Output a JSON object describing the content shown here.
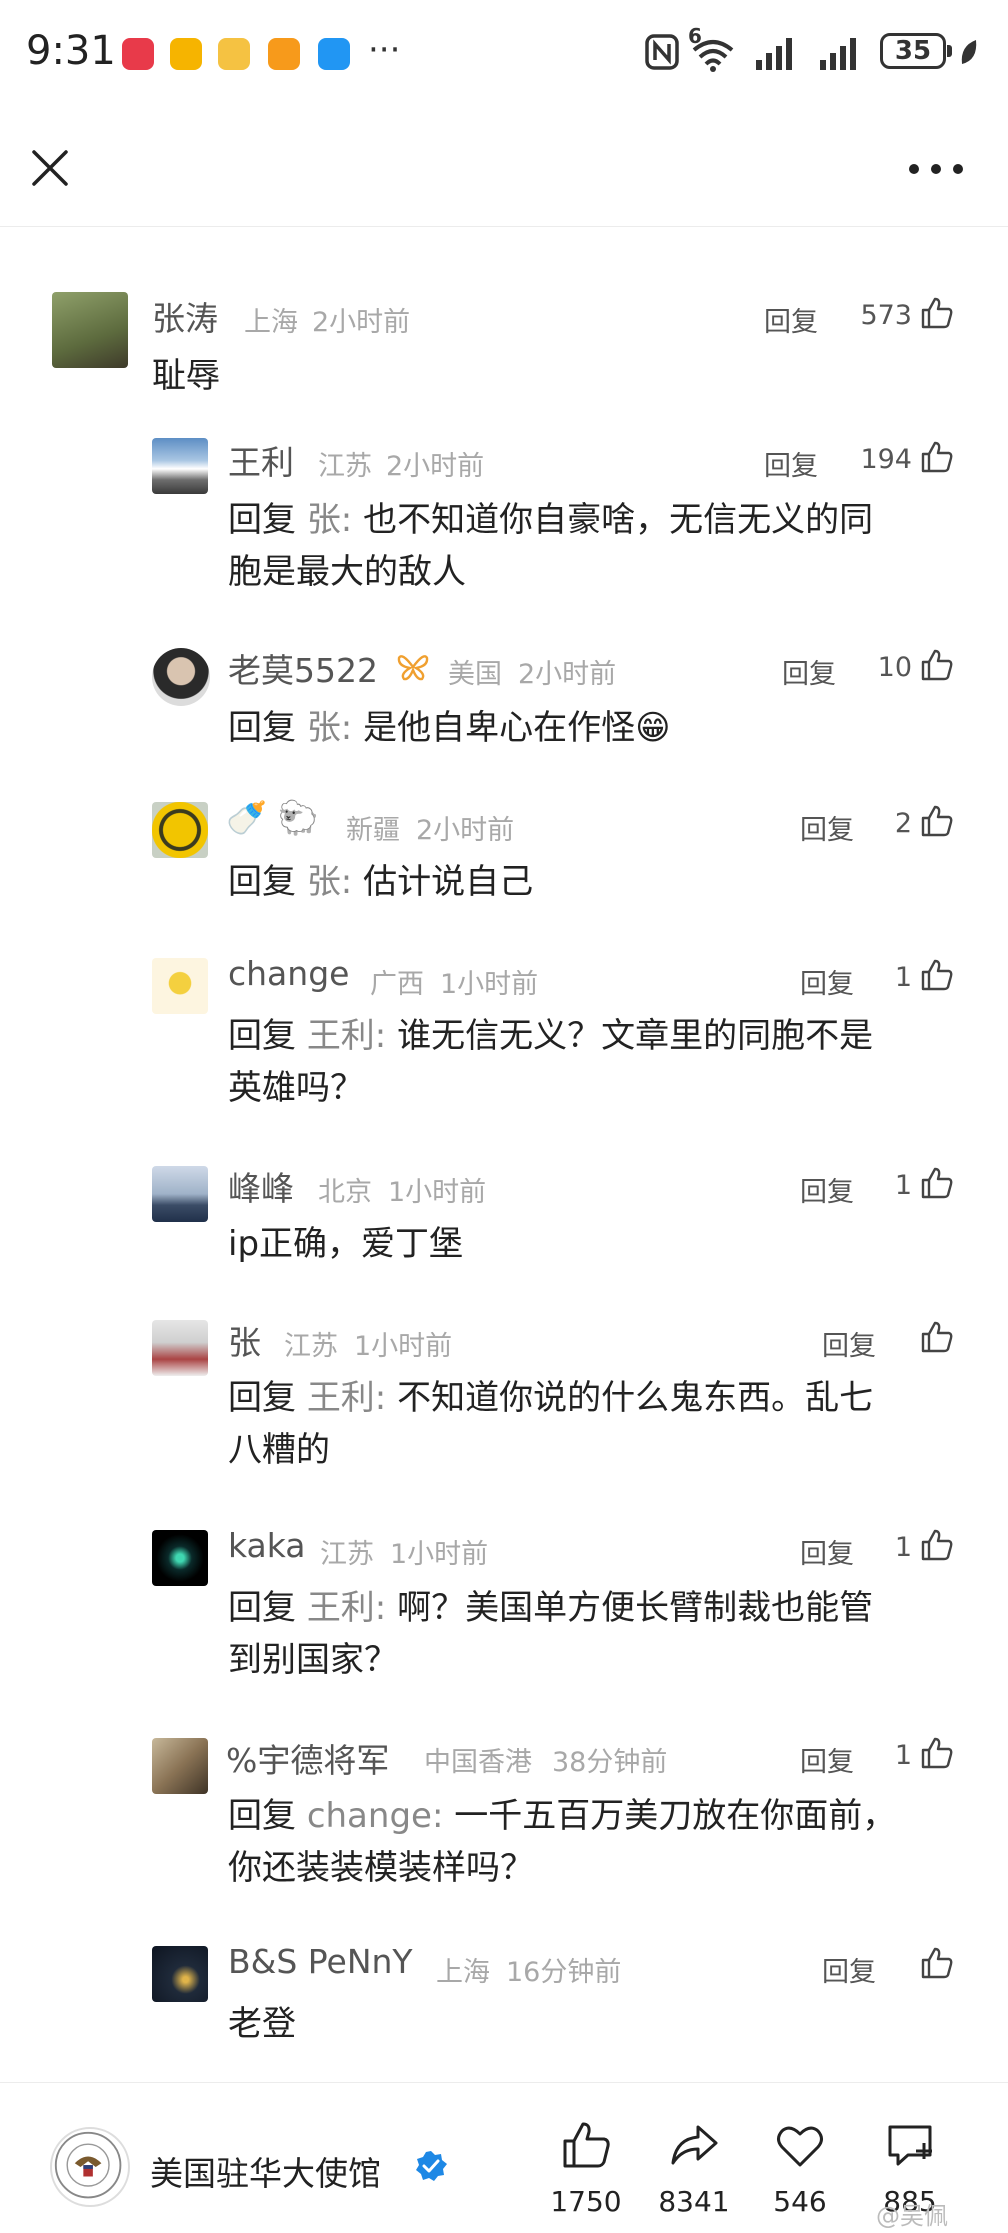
{
  "status": {
    "time": "9:31",
    "app_icons": [
      "huawei-store-icon",
      "email-icon",
      "weibo-icon",
      "app-icon",
      "message-icon"
    ],
    "more": "···",
    "network_label": "6",
    "battery": "35"
  },
  "comments": [
    {
      "user": "张涛",
      "location": "上海",
      "time": "2小时前",
      "reply": "回复",
      "likes": "573",
      "text": "耻辱"
    },
    {
      "user": "王利",
      "location": "江苏",
      "time": "2小时前",
      "reply": "回复",
      "likes": "194",
      "prefix": "回复 ",
      "target": "张:",
      "text": " 也不知道你自豪啥，无信无义的同\n胞是最大的敌人"
    },
    {
      "user": "老莫5522",
      "location": "美国",
      "time": "2小时前",
      "reply": "回复",
      "likes": "10",
      "prefix": "回复 ",
      "target": "张:",
      "text": " 是他自卑心在作怪😁"
    },
    {
      "user": "🍼 🐑",
      "location": "新疆",
      "time": "2小时前",
      "reply": "回复",
      "likes": "2",
      "prefix": "回复 ",
      "target": "张:",
      "text": " 估计说自己"
    },
    {
      "user": "change",
      "location": "广西",
      "time": "1小时前",
      "reply": "回复",
      "likes": "1",
      "prefix": "回复 ",
      "target": "王利:",
      "text": " 谁无信无义？文章里的同胞不是\n英雄吗？"
    },
    {
      "user": "峰峰",
      "location": "北京",
      "time": "1小时前",
      "reply": "回复",
      "likes": "1",
      "text": "ip正确，爱丁堡"
    },
    {
      "user": "张",
      "location": "江苏",
      "time": "1小时前",
      "reply": "回复",
      "likes": "",
      "prefix": "回复 ",
      "target": "王利:",
      "text": " 不知道你说的什么鬼东西。乱七\n八糟的"
    },
    {
      "user": "kaka",
      "location": "江苏",
      "time": "1小时前",
      "reply": "回复",
      "likes": "1",
      "prefix": "回复 ",
      "target": "王利:",
      "text": " 啊？美国单方便长臂制裁也能管\n到别国家？"
    },
    {
      "user": "%宇德将军",
      "location": "中国香港",
      "time": "38分钟前",
      "reply": "回复",
      "likes": "1",
      "prefix": "回复 ",
      "target": "change:",
      "text": " 一千五百万美刀放在你面前，\n你还装装模装样吗？"
    },
    {
      "user": "B&S PeNnY",
      "location": "上海",
      "time": "16分钟前",
      "reply": "回复",
      "likes": "",
      "text": "老登"
    }
  ],
  "bottom": {
    "account": "美国驻华大使馆",
    "like_count": "1750",
    "share_count": "8341",
    "fav_count": "546",
    "comment_count": "885",
    "watermark": "@吴佩"
  },
  "colors": {
    "verified": "#1e88e5",
    "meta": "#a8a8a8"
  }
}
